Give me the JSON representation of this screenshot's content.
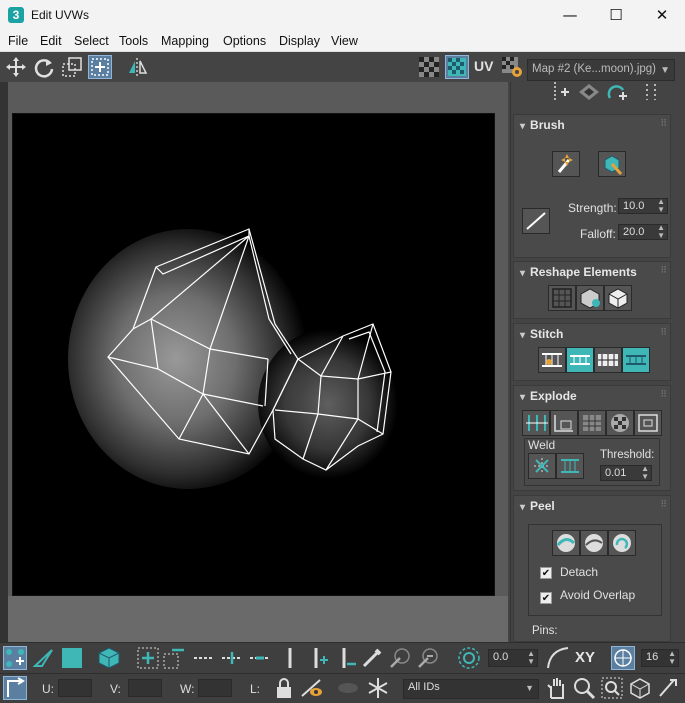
{
  "window": {
    "title": "Edit UVWs",
    "app_icon_glyph": "3",
    "minimize": "—",
    "maximize": "☐",
    "close": "✕"
  },
  "menu": [
    "File",
    "Edit",
    "Select",
    "Tools",
    "Mapping",
    "Options",
    "Display",
    "View"
  ],
  "toolbar": {
    "uv_label": "UV",
    "map_select": "Map #2 (Ke...moon).jpg)"
  },
  "panel": {
    "brush": {
      "title": "Brush",
      "strength_label": "Strength:",
      "strength_value": "10.0",
      "falloff_label": "Falloff:",
      "falloff_value": "20.0"
    },
    "reshape": {
      "title": "Reshape Elements"
    },
    "stitch": {
      "title": "Stitch"
    },
    "explode": {
      "title": "Explode",
      "weld_label": "Weld",
      "threshold_label": "Threshold:",
      "threshold_value": "0.01"
    },
    "peel": {
      "title": "Peel",
      "detach_label": "Detach",
      "detach_checked": "✔",
      "avoid_overlap_label": "Avoid Overlap",
      "avoid_overlap_checked": "✔",
      "pins_label": "Pins:"
    }
  },
  "bottom": {
    "xy_label": "XY",
    "rotation_value": "0.0",
    "grid_value": "16",
    "u_label": "U:",
    "v_label": "V:",
    "w_label": "W:",
    "l_label": "L:",
    "ids_select": "All IDs"
  },
  "colors": {
    "accent_teal": "#3fb7b7",
    "active_blue": "#5a7fa0",
    "panel_bg": "#444444",
    "viewport_bg": "#000000"
  }
}
